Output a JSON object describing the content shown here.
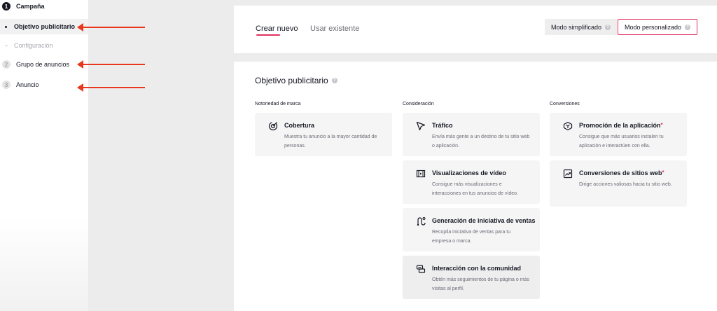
{
  "sidebar": {
    "steps": [
      {
        "number": "1",
        "label": "Campaña"
      },
      {
        "number": "2",
        "label": "Grupo de anuncios"
      },
      {
        "number": "3",
        "label": "Anuncio"
      }
    ],
    "substeps": [
      {
        "label": "Objetivo publicitario"
      },
      {
        "label": "Configuración"
      }
    ]
  },
  "header": {
    "tabs": [
      {
        "label": "Crear nuevo"
      },
      {
        "label": "Usar existente"
      }
    ],
    "modes": [
      {
        "label": "Modo simplificado"
      },
      {
        "label": "Modo personalizado"
      }
    ]
  },
  "main": {
    "title": "Objetivo publicitario",
    "columns": [
      {
        "label": "Notoriedad de marca",
        "cards": [
          {
            "icon": "target-icon",
            "title": "Cobertura",
            "required": false,
            "desc": "Muestra tu anuncio a la mayor cantidad de personas."
          }
        ]
      },
      {
        "label": "Consideración",
        "cards": [
          {
            "icon": "cursor-arrow-icon",
            "title": "Tráfico",
            "required": false,
            "desc": "Envía más gente a un destino de tu sitio web o aplicación."
          },
          {
            "icon": "film-icon",
            "title": "Visualizaciones de vídeo",
            "required": false,
            "desc": "Consigue más visualizaciones e interacciones en tus anuncios de vídeo."
          },
          {
            "icon": "funnel-path-icon",
            "title": "Generación de iniciativa de ventas",
            "required": false,
            "desc": "Recopila iniciativa de ventas para tu empresa o marca."
          },
          {
            "icon": "community-icon",
            "title": "Interacción con la comunidad",
            "required": false,
            "desc": "Obtén más seguimientos de tu página o más visitas al perfil."
          }
        ]
      },
      {
        "label": "Conversiones",
        "cards": [
          {
            "icon": "app-cube-icon",
            "title": "Promoción de la aplicación",
            "required": true,
            "desc": "Consigue que más usuarios instalen tu aplicación e interactúen con ella."
          },
          {
            "icon": "trend-chart-icon",
            "title": "Conversiones de sitios web",
            "required": true,
            "desc": "Dirige acciones valiosas hacia tu sitio web."
          }
        ]
      }
    ]
  },
  "colors": {
    "accent": "#e0325e",
    "annotation_arrow": "#e8391f",
    "card_bg": "#f5f5f6",
    "text_primary": "#161823",
    "text_secondary": "#6d6e75"
  }
}
